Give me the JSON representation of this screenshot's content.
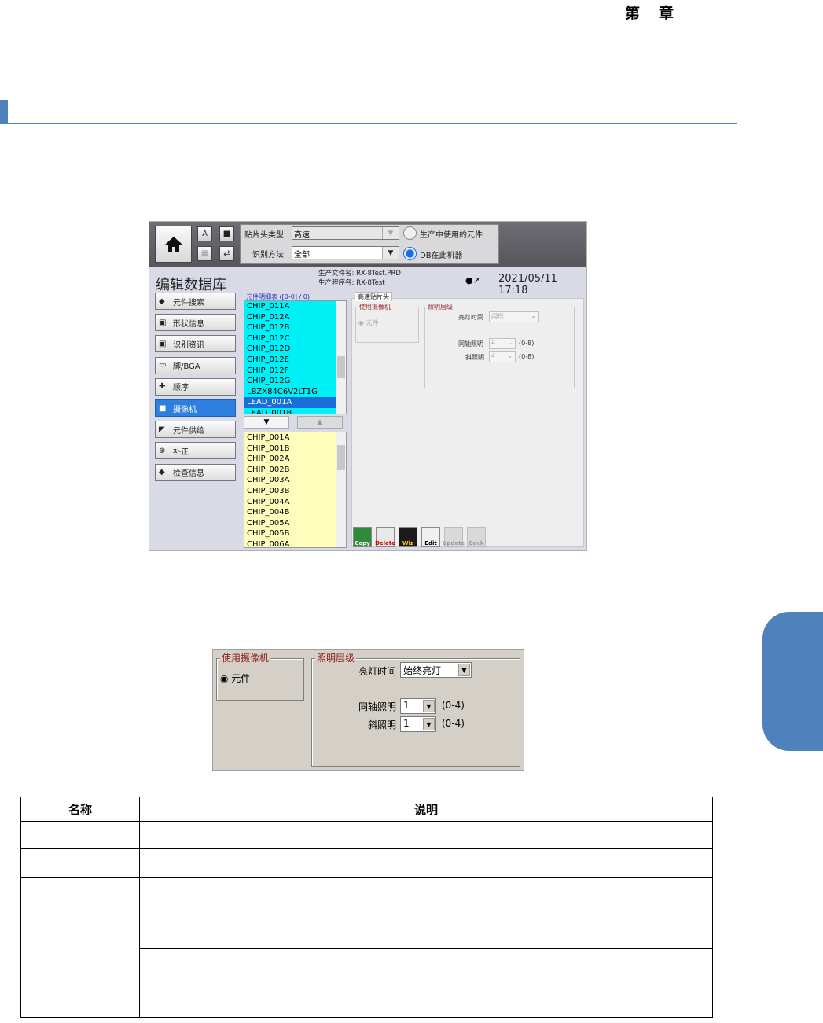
{
  "header": {
    "chapter_left": "第",
    "chapter_right": "章"
  },
  "ui": {
    "filters": {
      "head_type_label": "贴片头类型",
      "head_type_value": "高速",
      "method_label": "识别方法",
      "method_value": "全部",
      "radio_used_label": "生产中使用的元件",
      "radio_db_label": "DB在此机器"
    },
    "page_title": "编辑数据库",
    "file_name_label": "生产文件名",
    "file_name_value": "RX-8Test.PRD",
    "program_name_label": "生产程序名",
    "program_name_value": "RX-8Test",
    "datetime": "2021/05/11 17:18",
    "menu": [
      {
        "label": "元件搜索",
        "icon": "search-icon"
      },
      {
        "label": "形状信息",
        "icon": "shape-icon"
      },
      {
        "label": "识别资讯",
        "icon": "recognition-icon"
      },
      {
        "label": "脚/BGA",
        "icon": "chip-icon"
      },
      {
        "label": "顺序",
        "icon": "sequence-icon"
      },
      {
        "label": "摄像机",
        "icon": "camera-icon",
        "active": true
      },
      {
        "label": "元件供给",
        "icon": "feeder-icon"
      },
      {
        "label": "补正",
        "icon": "correction-icon"
      },
      {
        "label": "检查信息",
        "icon": "inspection-icon"
      }
    ],
    "list_title": "元件明细表 ([0-0] / 0)",
    "upper_list": [
      "CHIP_011A",
      "CHIP_012A",
      "CHIP_012B",
      "CHIP_012C",
      "CHIP_012D",
      "CHIP_012E",
      "CHIP_012F",
      "CHIP_012G",
      "LBZX84C6V2LT1G",
      "LEAD_001A",
      "LEAD_001B"
    ],
    "upper_selected_index": 9,
    "lower_list": [
      "CHIP_001A",
      "CHIP_001B",
      "CHIP_002A",
      "CHIP_002B",
      "CHIP_003A",
      "CHIP_003B",
      "CHIP_004A",
      "CHIP_004B",
      "CHIP_005A",
      "CHIP_005B",
      "CHIP_006A"
    ],
    "tab_label": "高速贴片头",
    "camera_group": "使用摄像机",
    "camera_option": "元件",
    "lighting_group": "照明层级",
    "light_time_label": "亮灯时间",
    "light_time_value": "闪烁",
    "coax_label": "同轴照明",
    "coax_value": "4",
    "coax_range": "(0-8)",
    "oblique_label": "斜照明",
    "oblique_value": "4",
    "oblique_range": "(0-8)",
    "toolbar": [
      "Copy",
      "Delete",
      "Wiz",
      "Edit",
      "Update",
      "Back"
    ]
  },
  "detail": {
    "camera_group": "使用摄像机",
    "camera_option": "元件",
    "lighting_group": "照明层级",
    "light_time_label": "亮灯时间",
    "light_time_value": "始终亮灯",
    "coax_label": "同轴照明",
    "coax_value": "1",
    "coax_range": "(0-4)",
    "oblique_label": "斜照明",
    "oblique_value": "1",
    "oblique_range": "(0-4)"
  },
  "table": {
    "col_name": "名称",
    "col_desc": "说明"
  }
}
